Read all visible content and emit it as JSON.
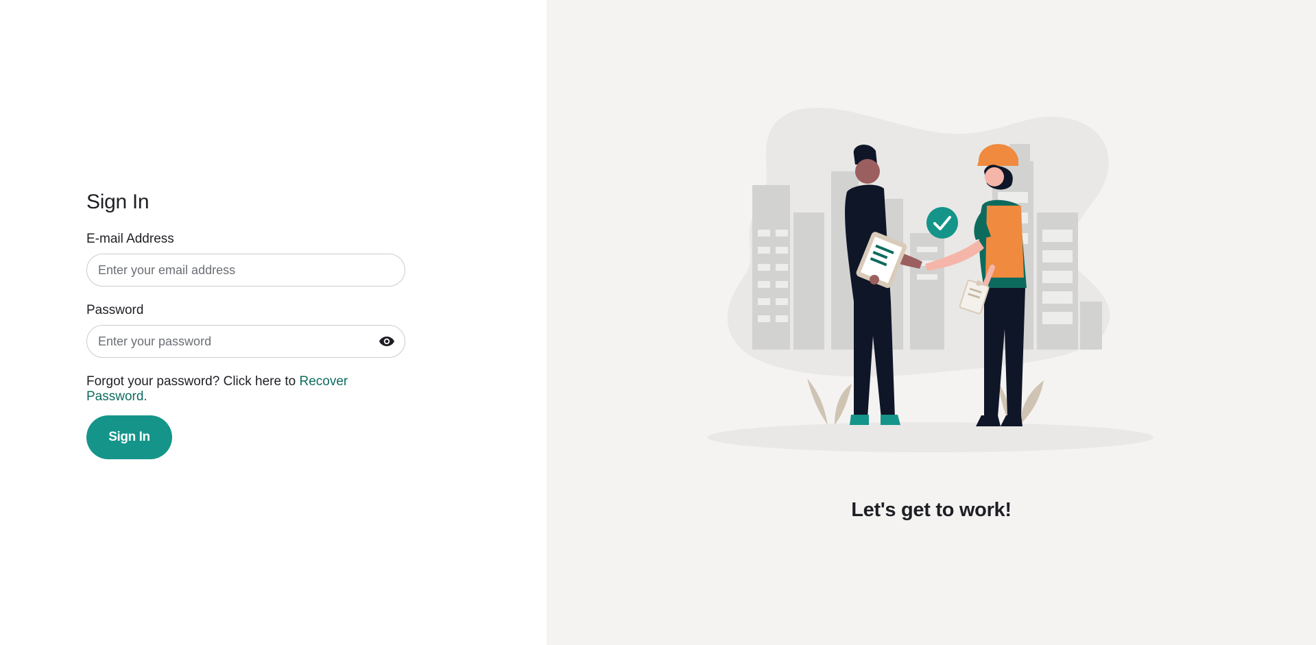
{
  "login": {
    "title": "Sign In",
    "email_label": "E-mail Address",
    "email_placeholder": "Enter your email address",
    "email_value": "",
    "password_label": "Password",
    "password_placeholder": "Enter your password",
    "password_value": "",
    "show_password_icon": "eye-icon",
    "forgot_text": "Forgot your password? Click here to ",
    "recover_link": "Recover Password.",
    "submit_label": "Sign In"
  },
  "hero": {
    "tagline": "Let's get to work!",
    "illustration": "handshake-illustration",
    "check_icon": "check-icon"
  },
  "colors": {
    "brand": "#159589",
    "link": "#0d6b5e",
    "panel_bg": "#f4f3f2",
    "accent_orange": "#ef8a3f"
  }
}
